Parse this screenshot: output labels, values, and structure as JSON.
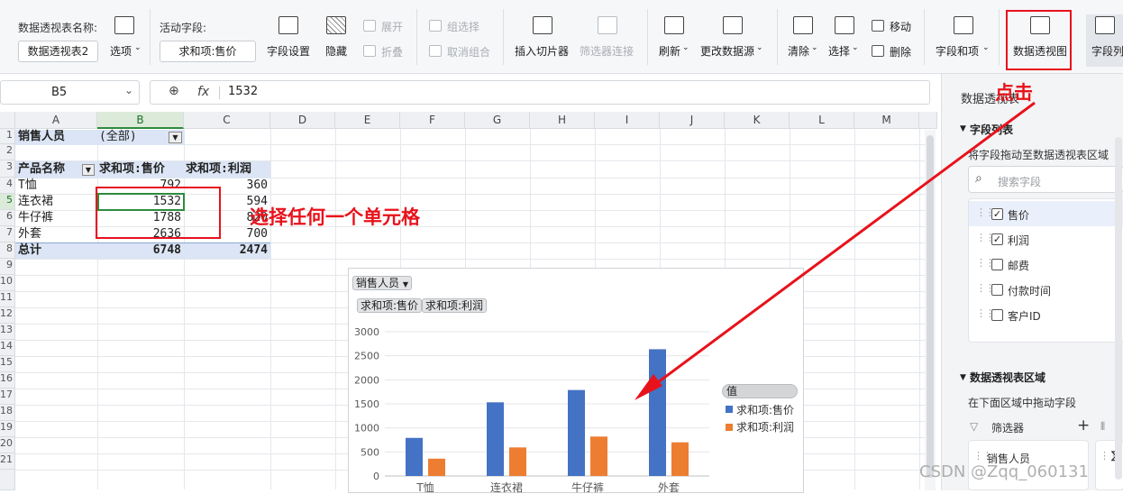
{
  "ribbon": {
    "pivot_name_label": "数据透视表名称:",
    "pivot_name_value": "数据透视表2",
    "options_label": "选项",
    "active_field_label": "活动字段:",
    "active_field_value": "求和项:售价",
    "field_settings": "字段设置",
    "hide": "隐藏",
    "expand": "展开",
    "collapse": "折叠",
    "group_selection": "组选择",
    "ungroup": "取消组合",
    "insert_slicer": "插入切片器",
    "filter_connections": "筛选器连接",
    "refresh": "刷新",
    "change_source": "更改数据源",
    "clear": "清除",
    "select": "选择",
    "move": "移动",
    "delete": "删除",
    "fields_items": "字段和项",
    "pivot_chart": "数据透视图",
    "field_list": "字段列"
  },
  "formula_bar": {
    "name_box": "B5",
    "fx": "fx",
    "content": "1532"
  },
  "sheet": {
    "columns": [
      "A",
      "B",
      "C",
      "D",
      "E",
      "F",
      "G",
      "H",
      "I",
      "J",
      "K",
      "L",
      "M"
    ],
    "rows": [
      "1",
      "2",
      "3",
      "4",
      "5",
      "6",
      "7",
      "8",
      "9",
      "10",
      "11",
      "12",
      "13",
      "14",
      "15",
      "16",
      "17",
      "18",
      "19",
      "20",
      "21"
    ],
    "a1": "销售人员",
    "b1": "(全部)",
    "header": {
      "product": "产品名称",
      "sum_price": "求和项:售价",
      "sum_profit": "求和项:利润"
    },
    "data": [
      {
        "product": "T恤",
        "price": "792",
        "profit": "360"
      },
      {
        "product": "连衣裙",
        "price": "1532",
        "profit": "594"
      },
      {
        "product": "牛仔裤",
        "price": "1788",
        "profit": "820"
      },
      {
        "product": "外套",
        "price": "2636",
        "profit": "700"
      }
    ],
    "total": {
      "label": "总计",
      "price": "6748",
      "profit": "2474"
    }
  },
  "chart_data": {
    "type": "bar",
    "filter_button": "销售人员",
    "value_buttons": [
      "求和项:售价",
      "求和项:利润"
    ],
    "categories": [
      "T恤",
      "连衣裙",
      "牛仔裤",
      "外套"
    ],
    "series": [
      {
        "name": "求和项:售价",
        "values": [
          792,
          1532,
          1788,
          2636
        ],
        "color": "#4472c4"
      },
      {
        "name": "求和项:利润",
        "values": [
          360,
          594,
          820,
          700
        ],
        "color": "#ed7d31"
      }
    ],
    "ylim": [
      0,
      3000
    ],
    "yticks": [
      "0",
      "500",
      "1000",
      "1500",
      "2000",
      "2500",
      "3000"
    ],
    "legend_title": "值",
    "legend_position": "right"
  },
  "pane": {
    "title": "数据透视表",
    "field_list_title": "字段列表",
    "field_list_hint": "将字段拖动至数据透视表区域",
    "search_placeholder": "搜索字段",
    "fields": [
      {
        "name": "售价",
        "checked": "✓"
      },
      {
        "name": "利润",
        "checked": "✓"
      },
      {
        "name": "邮费",
        "checked": ""
      },
      {
        "name": "付款时间",
        "checked": ""
      },
      {
        "name": "客户ID",
        "checked": ""
      }
    ],
    "areas_title": "数据透视表区域",
    "areas_hint": "在下面区域中拖动字段",
    "filters_label": "筛选器",
    "filter_item": "销售人员",
    "values_symbol": "∑"
  },
  "annotations": {
    "click": "点击",
    "select_any_cell": "选择任何一个单元格",
    "watermark": "CSDN @Zqq_060131"
  },
  "colors": {
    "annotation_red": "#e8121b",
    "selection_green": "#2e8b3e"
  }
}
